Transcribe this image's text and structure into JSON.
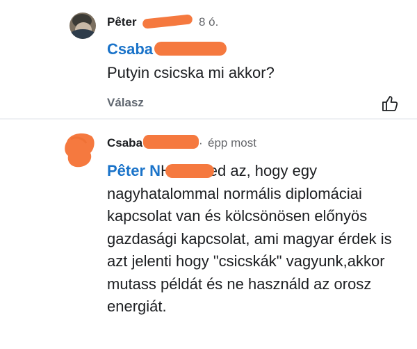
{
  "comments": [
    {
      "author": "Pêter",
      "time": "8 ó.",
      "mention": "Csaba",
      "text": "Putyin csicska mi akkor?",
      "reply_label": "Válasz",
      "like_icon": "thumbs-up-icon"
    },
    {
      "author": "Csaba",
      "separator": "·",
      "time": "épp most",
      "mention": "Pêter N",
      "text": "Ha neked az, hogy egy nagyhatalommal normális diplomáciai kapcsolat van és kölcsönösen előnyös gazdasági kapcsolat, ami magyar érdek is azt jelenti hogy \"csicskák\" vagyunk,akkor mutass példát és ne használd az orosz energiát."
    }
  ],
  "colors": {
    "mention": "#1a73c9",
    "redaction": "#f5793f",
    "meta": "#65676b"
  }
}
